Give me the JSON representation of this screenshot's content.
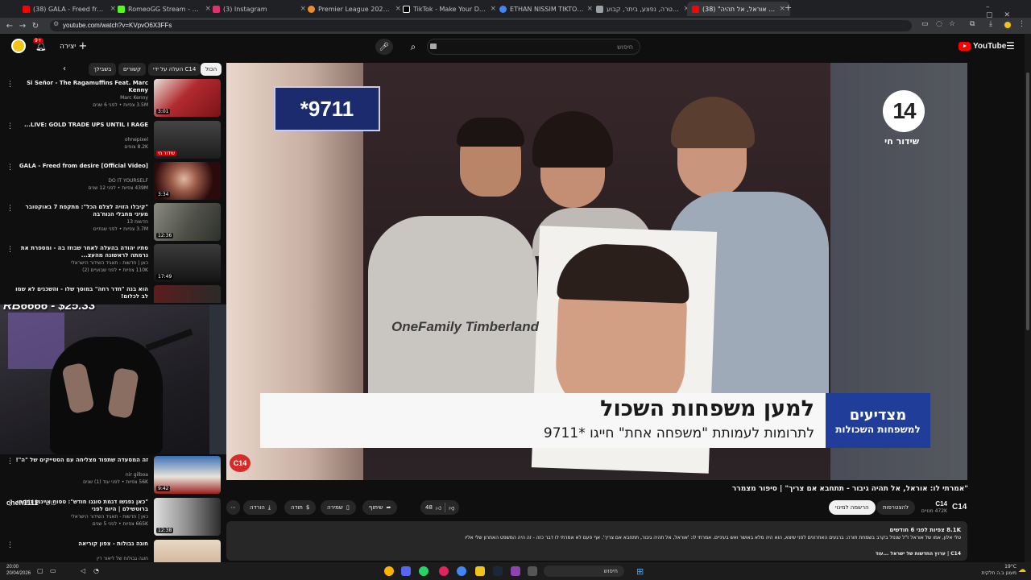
{
  "browser": {
    "tabs": [
      {
        "title": "(38) GALA - Freed from desire",
        "color": "#ff0000",
        "active": false
      },
      {
        "title": "RomeoGG Stream - Watch Live",
        "color": "#53fc18",
        "active": false
      },
      {
        "title": "(3) Instagram",
        "color": "#e1306c",
        "active": false
      },
      {
        "title": "Premier League 2026 table, Sta",
        "color": "#f08c2c",
        "active": false
      },
      {
        "title": "TikTok - Make Your Day",
        "color": "#ffffff",
        "active": false
      },
      {
        "title": "ETHAN NISSIM TIKTOK - חיפוש",
        "color": "#4285f4",
        "active": false
      },
      {
        "title": "ניצב משטרה, נפצע, ביתר, קבוע",
        "color": "#9aa0a6",
        "active": false
      },
      {
        "title": "(38) \"אמרתי לו: אוראל, אל תהיה",
        "color": "#ff0000",
        "active": true
      }
    ],
    "url": "youtube.com/watch?v=KVpvO6X3FFs"
  },
  "youtube": {
    "logo": "YouTube",
    "search_placeholder": "חיפוש",
    "create_label": "יצירה",
    "notif_count": "9+",
    "chips": [
      "הכול",
      "העלה על ידי C14",
      "קשורים",
      "בשבילך"
    ]
  },
  "recommendations": [
    {
      "title": "Si Señor - The Ragamuffins Feat. Marc Kenny",
      "channel": "Marc Kenny",
      "meta": "3.5M צפיות • לפני 6 שנים",
      "duration": "3:01",
      "color": "#b12a2e"
    },
    {
      "title": "LIVE: GOLD TRADE UPS UNTIL I RAGE...",
      "channel": "ohnepixel",
      "meta": "8.2K צופים",
      "duration": "שידור חי",
      "color": "#3a3a3a"
    },
    {
      "title": "GALA - Freed from desire [Official Video]",
      "channel": "DO IT YOURSELF",
      "meta": "439M צפיות • לפני 12 שנים",
      "duration": "3:34",
      "color": "#7c1010"
    },
    {
      "title": "\"קיבלו הזויה לצלם הכל\": מתקפת 7 באוקטובר מעיני מחבלי הנוח'בה",
      "channel": "חדשות 13",
      "meta": "3.7M צפיות • לפני שנתיים",
      "duration": "12:36",
      "color": "#5a5a55"
    },
    {
      "title": "סתיו יהודה בהעלה לאחר שבוזז בה - ומספרת את נרמתה לראשונה מהעצ...",
      "channel": "כאן | חדשות - תאגיד השידור הישראלי",
      "meta": "110K צפיות • לפני שבועיים (2)",
      "duration": "17:49",
      "color": "#222"
    },
    {
      "title": "הוא בנה \"חדר רחה\" במוסך שלו - והשכנים לא שמו לב לכלום!",
      "channel": "",
      "meta": "",
      "duration": "",
      "color": "#5c1d1d"
    },
    {
      "title": "זה המסעדה שתפוד מצליחה עם הסטייקים של \"ה\"!",
      "channel": "nir gilboa",
      "meta": "56K צפיות • לפני עוד (1) שנים",
      "duration": "9:42",
      "color": "#9b2020"
    },
    {
      "title": "\"כאן נפגשו דגמת סוגגו חודש\": טסוח איינמן נתפחו ברוטשילם | היום לפני",
      "channel": "כאן | חדשות - תאגיד השידור הישראלי",
      "meta": "665K צפיות • לפני 5 שנים",
      "duration": "12:38",
      "color": "#bdbdbd"
    },
    {
      "title": "חוגה גבולות - צפון קוריאה",
      "channel": "חוגה גבולות של ליאור דין",
      "meta": "",
      "duration": "",
      "color": "#c9a385"
    }
  ],
  "streamer_overlay": {
    "donation": "RB6666 - $25.33"
  },
  "chat": {
    "user": "chen1111",
    "msg": "כושי"
  },
  "video": {
    "title": "\"אמרתי לו: אוראל, אל תהיה גיבור - תתחבא אם צריך\" | סיפור מצמרר",
    "channel": "C14",
    "subs": "472K מנויים",
    "subscribe_label": "להצטרפות",
    "join_label": "הרשמה למינוי",
    "likes": "48",
    "share": "שיתוף",
    "save": "שמירה",
    "thanks": "תודה",
    "download": "הורדה",
    "overlay_number": "*9711",
    "live_badge": "שידור חי",
    "logo_num": "14",
    "banner_main": "למען משפחות השכול",
    "banner_sub": "לתרומות לעמותת \"משפחה אחת\" חייגו *9711",
    "banner_side_1": "מצדיעים",
    "banner_side_2": "למשפחות השכולות",
    "watermark": "C14",
    "shirt_text": "OneFamily Timberland"
  },
  "description": {
    "stats": "8.1K צפיות  לפני 6 חודשים",
    "line1": "טלי אלון, אמו של אוראל ז\"ל שנפל בקרב בשמחת תורה: ברגעים האחרונים לפני שיצא, הוא היה מלא באושר ואש בעיניים. אמרתי לו: 'אוראל, אל תהיה גיבור, תתחבא אם צריך'. אף פעם לא אמרתי לו דבר כזה - זה היה המשפט האחרון שלי אליו",
    "line2": "C14 | ערוץ החדשות של ישראל ...עוד"
  },
  "taskbar": {
    "search": "חיפוש",
    "time": "20:00",
    "date": "20/04/2026",
    "weather": "19°C",
    "weather_sub": "מעונן ב.ה חלקית"
  },
  "colors": {
    "yt_red": "#ff0000",
    "bg": "#0f0f0f",
    "banner_blue": "#1f3d99"
  }
}
